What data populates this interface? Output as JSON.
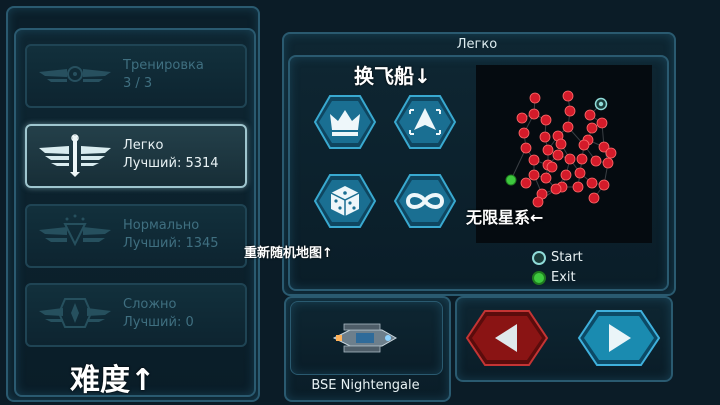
{
  "map_header": "Легко",
  "difficulties": [
    {
      "name": "Тренировка",
      "best": "3 / 3",
      "active": false
    },
    {
      "name": "Легко",
      "best": "Лучший: 5314",
      "active": true
    },
    {
      "name": "Нормально",
      "best": "Лучший: 1345",
      "active": false
    },
    {
      "name": "Сложно",
      "best": "Лучший: 0",
      "active": false
    }
  ],
  "buttons": {
    "crown": "crown-icon",
    "ship": "ship-icon",
    "dice": "dice-icon",
    "infinity": "infinity-icon",
    "prev": "arrow-left-icon",
    "next": "arrow-right-icon"
  },
  "annotations": {
    "change_ship": "换飞船↓",
    "infinite_galaxy": "无限星系←",
    "rerandom_map": "重新随机地图↑",
    "difficulty": "难度↑"
  },
  "legend": {
    "start": "Start",
    "exit": "Exit"
  },
  "ship_name": "BSE Nightengale",
  "colors": {
    "node_red": "#d41b2a",
    "start_teal": "#8fdbd8",
    "exit_green": "#3ec83e",
    "prev_button": "#8a1414",
    "next_button": "#1a8bb0"
  }
}
